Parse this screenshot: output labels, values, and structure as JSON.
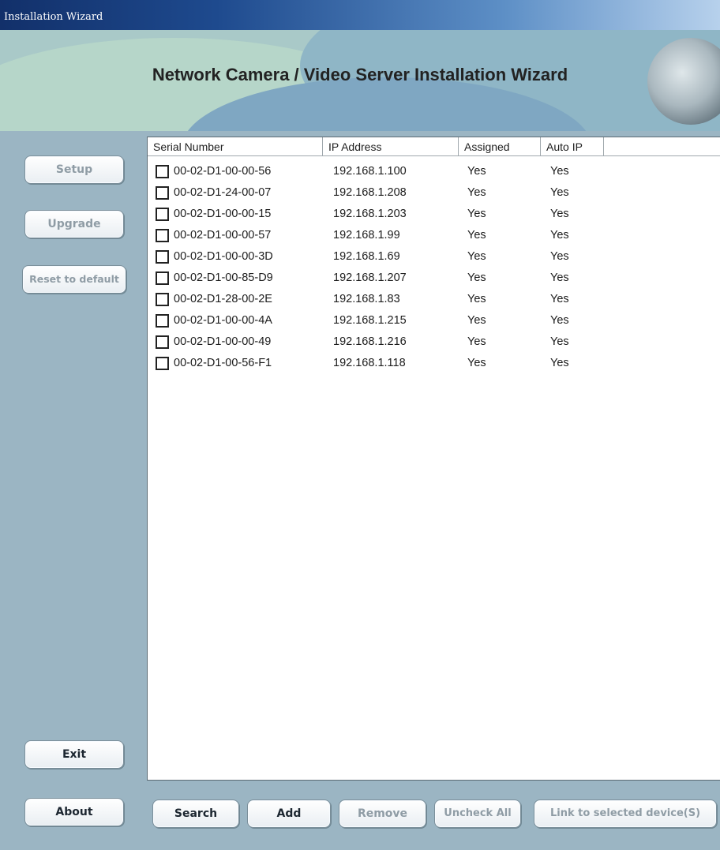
{
  "window": {
    "title": "Installation Wizard"
  },
  "banner": {
    "title": "Network Camera / Video Server Installation Wizard"
  },
  "sidebar": {
    "setup": "Setup",
    "upgrade": "Upgrade",
    "reset": "Reset to default",
    "exit": "Exit",
    "about": "About"
  },
  "table": {
    "headers": [
      "Serial Number",
      "IP Address",
      "Assigned",
      "Auto IP"
    ],
    "rows": [
      {
        "serial": "00-02-D1-00-00-56",
        "ip": "192.168.1.100",
        "assigned": "Yes",
        "auto": "Yes"
      },
      {
        "serial": "00-02-D1-24-00-07",
        "ip": "192.168.1.208",
        "assigned": "Yes",
        "auto": "Yes"
      },
      {
        "serial": "00-02-D1-00-00-15",
        "ip": "192.168.1.203",
        "assigned": "Yes",
        "auto": "Yes"
      },
      {
        "serial": "00-02-D1-00-00-57",
        "ip": "192.168.1.99",
        "assigned": "Yes",
        "auto": "Yes"
      },
      {
        "serial": "00-02-D1-00-00-3D",
        "ip": "192.168.1.69",
        "assigned": "Yes",
        "auto": "Yes"
      },
      {
        "serial": "00-02-D1-00-85-D9",
        "ip": "192.168.1.207",
        "assigned": "Yes",
        "auto": "Yes"
      },
      {
        "serial": "00-02-D1-28-00-2E",
        "ip": "192.168.1.83",
        "assigned": "Yes",
        "auto": "Yes"
      },
      {
        "serial": "00-02-D1-00-00-4A",
        "ip": "192.168.1.215",
        "assigned": "Yes",
        "auto": "Yes"
      },
      {
        "serial": "00-02-D1-00-00-49",
        "ip": "192.168.1.216",
        "assigned": "Yes",
        "auto": "Yes"
      },
      {
        "serial": "00-02-D1-00-56-F1",
        "ip": "192.168.1.118",
        "assigned": "Yes",
        "auto": "Yes"
      }
    ]
  },
  "toolbar": {
    "search": "Search",
    "add": "Add",
    "remove": "Remove",
    "uncheck_all": "Uncheck All",
    "link": "Link to selected device(S)"
  },
  "colors": {
    "background": "#9bb5c3",
    "titlebar_start": "#12306a",
    "titlebar_end": "#b7d1ec",
    "banner": "#a9c9c8"
  },
  "icons": {
    "checkbox": "checkbox-icon",
    "banner_graphic": "eye-graphic-icon"
  }
}
